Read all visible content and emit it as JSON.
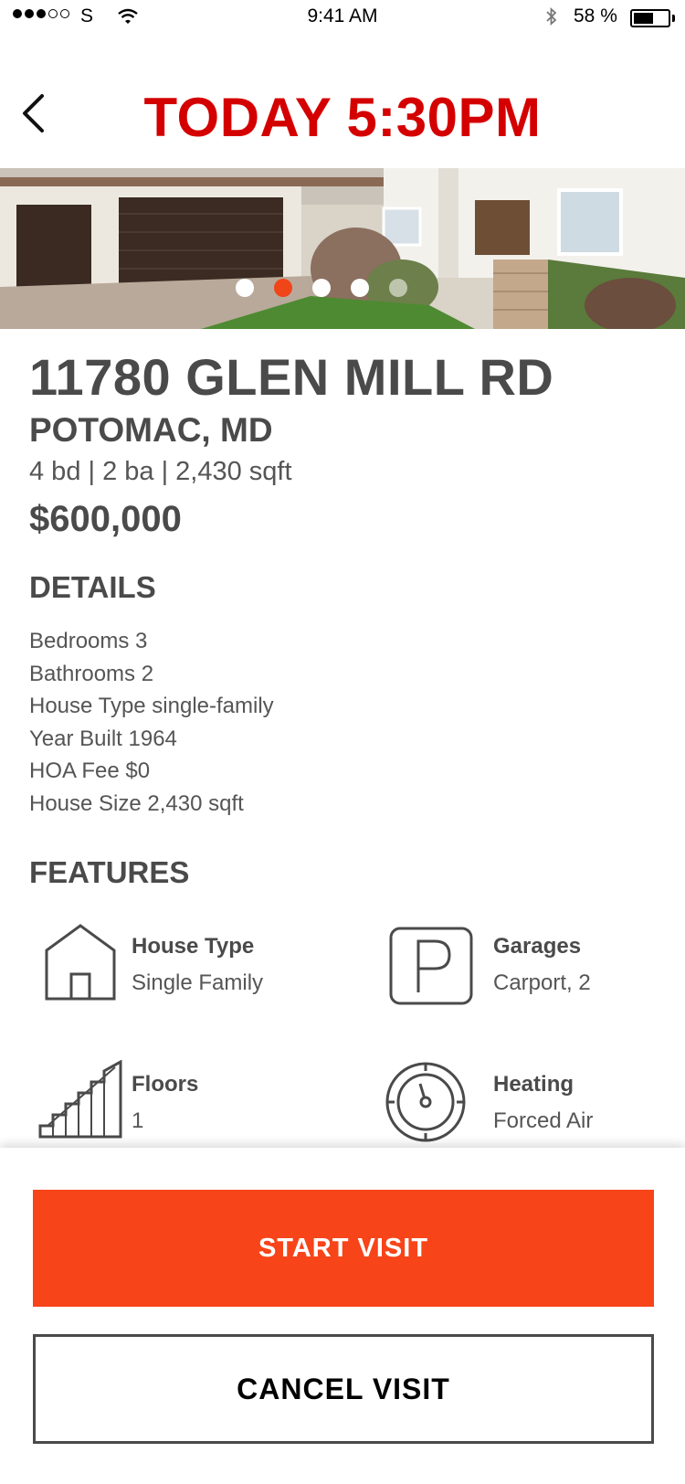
{
  "status_bar": {
    "carrier": "S",
    "time": "9:41 AM",
    "battery_percent": "58 %",
    "battery_level": 0.58,
    "signal_filled": 3,
    "signal_total": 5
  },
  "header": {
    "title": "TODAY 5:30PM",
    "title_color": "#d40000"
  },
  "carousel": {
    "total": 5,
    "active_index": 1,
    "active_color": "#f04519"
  },
  "listing": {
    "address": "11780 GLEN MILL RD",
    "city": "POTOMAC, MD",
    "summary": "4 bd | 2 ba | 2,430 sqft",
    "price": "$600,000"
  },
  "details": {
    "title": "DETAILS",
    "rows": [
      "Bedrooms  3",
      "Bathrooms  2",
      "House Type  single-family",
      "Year Built  1964",
      "HOA Fee  $0",
      "House Size  2,430 sqft"
    ]
  },
  "features": {
    "title": "FEATURES",
    "items": [
      {
        "label": "House Type",
        "value": "Single Family",
        "icon": "house-icon"
      },
      {
        "label": "Garages",
        "value": "Carport, 2",
        "icon": "parking-icon"
      },
      {
        "label": "Floors",
        "value": "1",
        "icon": "stairs-icon"
      },
      {
        "label": "Heating",
        "value": "Forced Air",
        "icon": "thermostat-icon"
      }
    ]
  },
  "actions": {
    "start_label": "START VISIT",
    "cancel_label": "CANCEL VISIT",
    "accent_color": "#f74419"
  }
}
